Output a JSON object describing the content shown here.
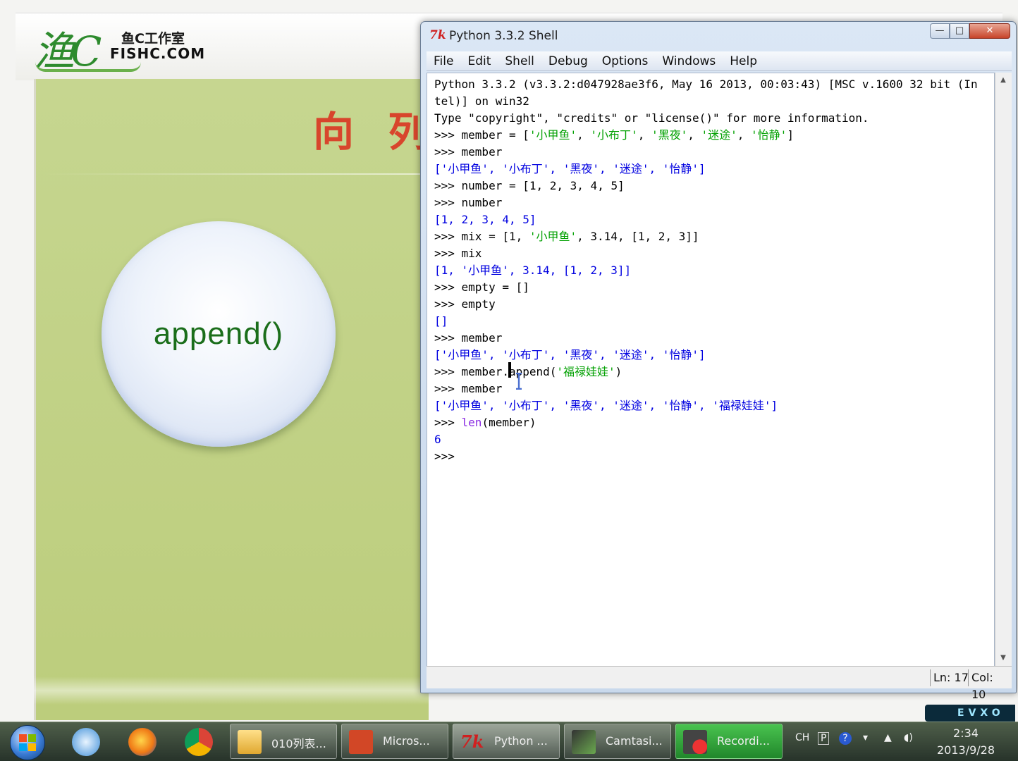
{
  "slide": {
    "logo_script": "渔C",
    "logo_cn": "鱼C工作室",
    "logo_en": "FISHC.COM",
    "title": "向 列",
    "circle_label": "append()"
  },
  "window": {
    "icon": "7k",
    "title": "Python 3.3.2 Shell",
    "buttons": {
      "minimize": "—",
      "maximize": "□",
      "close": "✕"
    }
  },
  "menu": [
    "File",
    "Edit",
    "Shell",
    "Debug",
    "Options",
    "Windows",
    "Help"
  ],
  "shell_lines": [
    [
      {
        "t": "Python 3.3.2 (v3.3.2:d047928ae3f6, May 16 2013, 00:03:43) [MSC v.1600 32 bit (In",
        "c": ""
      }
    ],
    [
      {
        "t": "tel)] on win32",
        "c": ""
      }
    ],
    [
      {
        "t": "Type \"copyright\", \"credits\" or \"license()\" for more information.",
        "c": ""
      }
    ],
    [
      {
        "t": ">>> member = [",
        "c": ""
      },
      {
        "t": "'小甲鱼'",
        "c": "s"
      },
      {
        "t": ", ",
        "c": ""
      },
      {
        "t": "'小布丁'",
        "c": "s"
      },
      {
        "t": ", ",
        "c": ""
      },
      {
        "t": "'黑夜'",
        "c": "s"
      },
      {
        "t": ", ",
        "c": ""
      },
      {
        "t": "'迷途'",
        "c": "s"
      },
      {
        "t": ", ",
        "c": ""
      },
      {
        "t": "'怡静'",
        "c": "s"
      },
      {
        "t": "]",
        "c": ""
      }
    ],
    [
      {
        "t": ">>> member",
        "c": ""
      }
    ],
    [
      {
        "t": "['小甲鱼', '小布丁', '黑夜', '迷途', '怡静']",
        "c": "o"
      }
    ],
    [
      {
        "t": ">>> number = [1, 2, 3, 4, 5]",
        "c": ""
      }
    ],
    [
      {
        "t": ">>> number",
        "c": ""
      }
    ],
    [
      {
        "t": "[1, 2, 3, 4, 5]",
        "c": "o"
      }
    ],
    [
      {
        "t": ">>> mix = [1, ",
        "c": ""
      },
      {
        "t": "'小甲鱼'",
        "c": "s"
      },
      {
        "t": ", 3.14, [1, 2, 3]]",
        "c": ""
      }
    ],
    [
      {
        "t": ">>> mix",
        "c": ""
      }
    ],
    [
      {
        "t": "[1, '小甲鱼', 3.14, [1, 2, 3]]",
        "c": "o"
      }
    ],
    [
      {
        "t": ">>> empty = []",
        "c": ""
      }
    ],
    [
      {
        "t": ">>> empty",
        "c": ""
      }
    ],
    [
      {
        "t": "[]",
        "c": "o"
      }
    ],
    [
      {
        "t": ">>> member",
        "c": ""
      }
    ],
    [
      {
        "t": "['小甲鱼', '小布丁', '黑夜', '迷途', '怡静']",
        "c": "o"
      }
    ],
    [
      {
        "t": ">>> member.append(",
        "c": ""
      },
      {
        "t": "'福禄娃娃'",
        "c": "s"
      },
      {
        "t": ")",
        "c": ""
      }
    ],
    [
      {
        "t": ">>> member",
        "c": ""
      }
    ],
    [
      {
        "t": "['小甲鱼', '小布丁', '黑夜', '迷途', '怡静', '福禄娃娃']",
        "c": "o"
      }
    ],
    [
      {
        "t": ">>> ",
        "c": ""
      },
      {
        "t": "len",
        "c": "b"
      },
      {
        "t": "(member)",
        "c": ""
      }
    ],
    [
      {
        "t": "6",
        "c": "o"
      }
    ],
    [
      {
        "t": ">>> ",
        "c": ""
      }
    ]
  ],
  "status": {
    "ln": "Ln: 17",
    "col": "Col: 10"
  },
  "watermark": "EVXO",
  "taskbar": {
    "tasks": [
      {
        "label": "010列表...",
        "icon": "folder-icon"
      },
      {
        "label": "Micros...",
        "icon": "powerpoint-icon"
      },
      {
        "label": "Python ...",
        "icon": "python-idle-icon"
      },
      {
        "label": "Camtasi...",
        "icon": "camtasia-icon"
      },
      {
        "label": "Recordi...",
        "icon": "recording-icon"
      }
    ],
    "tray_lang": "CH",
    "time": "2:34",
    "date": "2013/9/28"
  }
}
